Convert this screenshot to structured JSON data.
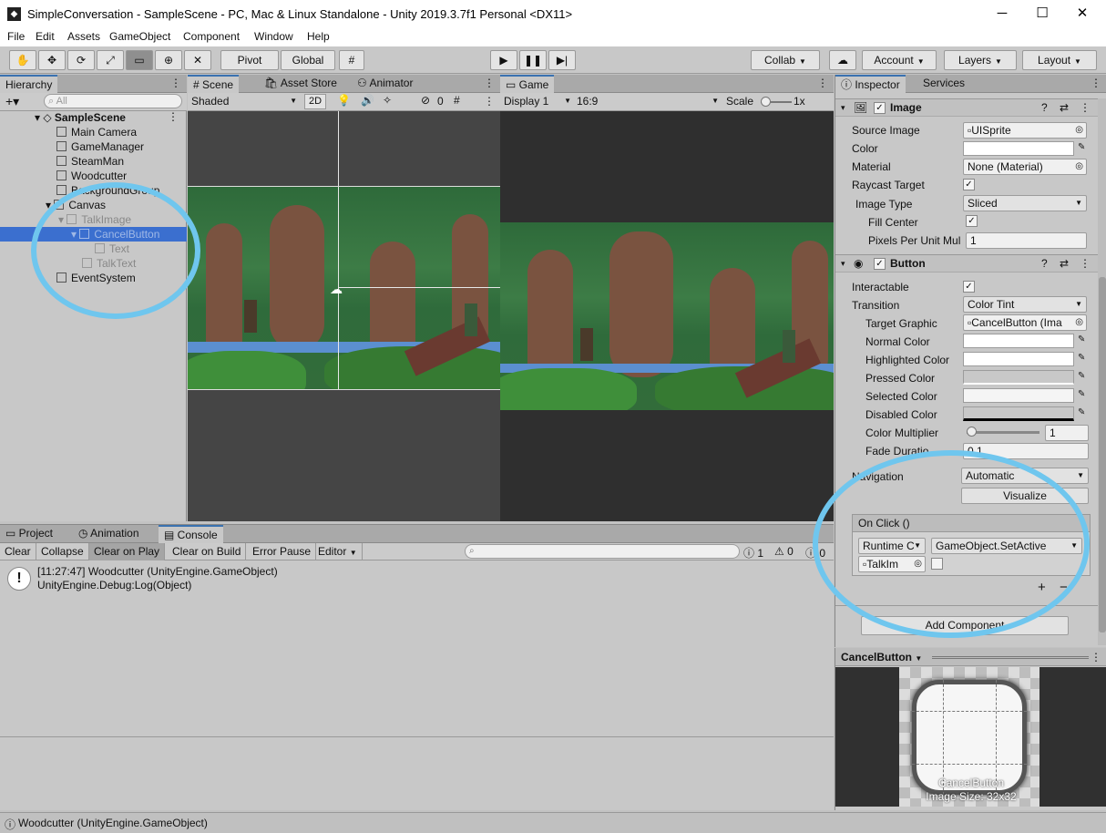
{
  "window": {
    "title": "SimpleConversation - SampleScene - PC, Mac & Linux Standalone - Unity 2019.3.7f1 Personal <DX11>",
    "minimize": "─",
    "maximize": "☐",
    "close": "✕"
  },
  "menu": [
    "File",
    "Edit",
    "Assets",
    "GameObject",
    "Component",
    "Window",
    "Help"
  ],
  "toolbar": {
    "pivot": "Pivot",
    "global": "Global",
    "collab": "Collab",
    "account": "Account",
    "layers": "Layers",
    "layout": "Layout"
  },
  "hierarchy": {
    "tab": "Hierarchy",
    "search_placeholder": "All",
    "scene": "SampleScene",
    "items": [
      {
        "label": "Main Camera"
      },
      {
        "label": "GameManager"
      },
      {
        "label": "SteamMan"
      },
      {
        "label": "Woodcutter"
      },
      {
        "label": "BackgroundGroup"
      },
      {
        "label": "Canvas"
      },
      {
        "label": "TalkImage"
      },
      {
        "label": "CancelButton"
      },
      {
        "label": "Text"
      },
      {
        "label": "TalkText"
      },
      {
        "label": "EventSystem"
      }
    ]
  },
  "scene": {
    "tabs": [
      "Scene",
      "Asset Store",
      "Animator"
    ],
    "shading": "Shaded",
    "mode2d": "2D",
    "gizmo_count": "0"
  },
  "game": {
    "tab": "Game",
    "display": "Display 1",
    "aspect": "16:9",
    "scale_label": "Scale",
    "scale_value": "1x"
  },
  "inspector": {
    "tabs": [
      "Inspector",
      "Services"
    ],
    "image": {
      "header": "Image",
      "source_image_label": "Source Image",
      "source_image": "UISprite",
      "color_label": "Color",
      "material_label": "Material",
      "material": "None (Material)",
      "raycast_label": "Raycast Target",
      "image_type_label": "Image Type",
      "image_type": "Sliced",
      "fill_center_label": "Fill Center",
      "ppu_label": "Pixels Per Unit Mul",
      "ppu": "1"
    },
    "button": {
      "header": "Button",
      "interactable_label": "Interactable",
      "transition_label": "Transition",
      "transition": "Color Tint",
      "target_graphic_label": "Target Graphic",
      "target_graphic": "CancelButton (Ima",
      "normal_label": "Normal Color",
      "highlighted_label": "Highlighted Color",
      "pressed_label": "Pressed Color",
      "selected_label": "Selected Color",
      "disabled_label": "Disabled Color",
      "multiplier_label": "Color Multiplier",
      "multiplier": "1",
      "multiplier_level": 0,
      "fade_label": "Fade Duratio",
      "fade": "0.1",
      "navigation_label": "Navigation",
      "navigation": "Automatic",
      "visualize": "Visualize",
      "onclick_header": "On Click ()",
      "runtime": "Runtime C",
      "function": "GameObject.SetActive",
      "target_object": "TalkIm",
      "plus": "+",
      "minus": "−"
    },
    "add_component": "Add Component"
  },
  "preview": {
    "title": "CancelButton",
    "name": "CancelButton",
    "size": "Image Size: 32x32"
  },
  "console": {
    "tabs": [
      "Project",
      "Animation",
      "Console"
    ],
    "buttons": [
      "Clear",
      "Collapse",
      "Clear on Play",
      "Clear on Build",
      "Error Pause",
      "Editor"
    ],
    "counts": {
      "log": "1",
      "warn": "0",
      "error": "0"
    },
    "entry_line1": "[11:27:47] Woodcutter (UnityEngine.GameObject)",
    "entry_line2": "UnityEngine.Debug:Log(Object)"
  },
  "status": "Woodcutter (UnityEngine.GameObject)",
  "colors": {
    "accent": "#3a72b0",
    "annotation": "#6fc6ee",
    "selection": "#3b6fcf"
  }
}
